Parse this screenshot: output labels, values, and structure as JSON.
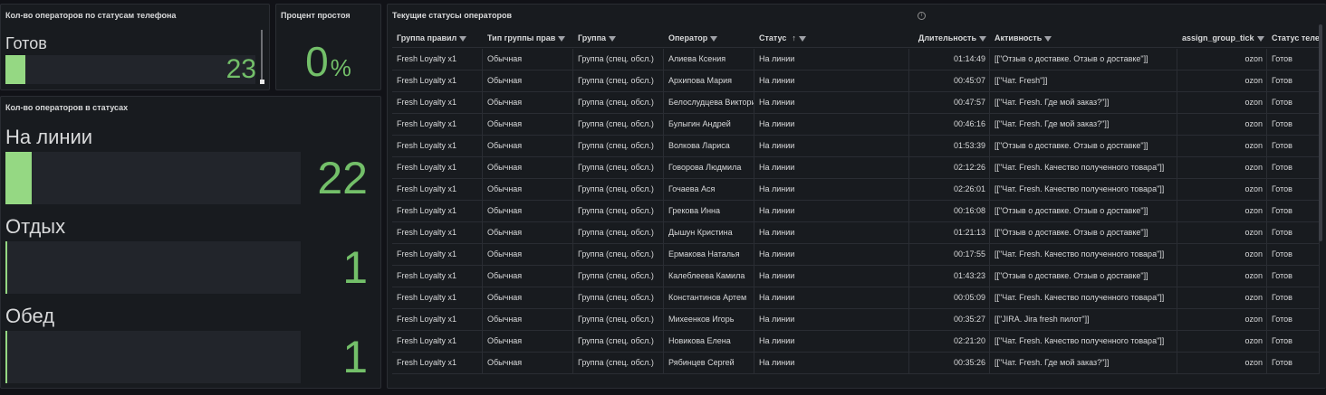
{
  "panel_phone": {
    "title": "Кол-во операторов по статусам телефона",
    "label": "Готов",
    "value": "23",
    "fill": 0.08
  },
  "panel_idle": {
    "title": "Процент простоя",
    "value": "0",
    "unit": "%"
  },
  "panel_status": {
    "title": "Кол-во операторов в статусах",
    "rows": [
      {
        "label": "На линии",
        "value": "22",
        "fill": 0.09
      },
      {
        "label": "Отдых",
        "value": "1",
        "fill": 0.005
      },
      {
        "label": "Обед",
        "value": "1",
        "fill": 0.005
      }
    ]
  },
  "panel_table": {
    "title": "Текущие статусы операторов",
    "info_icon": "info-icon",
    "columns": [
      "Группа правил",
      "Тип группы прав",
      "Группа",
      "Оператор",
      "Статус",
      "Длительность",
      "Активность",
      "assign_group_tick",
      "Статус теле"
    ],
    "sort_indicator": "↑",
    "rows": [
      [
        "Fresh Loyalty x1",
        "Обычная",
        "Группа (спец. обсл.)",
        "Алиева Ксения",
        "На линии",
        "01:14:49",
        "[[\"Отзыв о доставке. Отзыв о доставке\"]]",
        "ozon",
        "Готов"
      ],
      [
        "Fresh Loyalty x1",
        "Обычная",
        "Группа (спец. обсл.)",
        "Архипова Мария",
        "На линии",
        "00:45:07",
        "[[\"Чат. Fresh\"]]",
        "ozon",
        "Готов"
      ],
      [
        "Fresh Loyalty x1",
        "Обычная",
        "Группа (спец. обсл.)",
        "Белослудцева Виктория",
        "На линии",
        "00:47:57",
        "[[\"Чат. Fresh. Где мой заказ?\"]]",
        "ozon",
        "Готов"
      ],
      [
        "Fresh Loyalty x1",
        "Обычная",
        "Группа (спец. обсл.)",
        "Булыгин Андрей",
        "На линии",
        "00:46:16",
        "[[\"Чат. Fresh. Где мой заказ?\"]]",
        "ozon",
        "Готов"
      ],
      [
        "Fresh Loyalty x1",
        "Обычная",
        "Группа (спец. обсл.)",
        "Волкова Лариса",
        "На линии",
        "01:53:39",
        "[[\"Отзыв о доставке. Отзыв о доставке\"]]",
        "ozon",
        "Готов"
      ],
      [
        "Fresh Loyalty x1",
        "Обычная",
        "Группа (спец. обсл.)",
        "Говорова Людмила",
        "На линии",
        "02:12:26",
        "[[\"Чат. Fresh. Качество полученного товара\"]]",
        "ozon",
        "Готов"
      ],
      [
        "Fresh Loyalty x1",
        "Обычная",
        "Группа (спец. обсл.)",
        "Гочаева Ася",
        "На линии",
        "02:26:01",
        "[[\"Чат. Fresh. Качество полученного товара\"]]",
        "ozon",
        "Готов"
      ],
      [
        "Fresh Loyalty x1",
        "Обычная",
        "Группа (спец. обсл.)",
        "Грекова Инна",
        "На линии",
        "00:16:08",
        "[[\"Отзыв о доставке. Отзыв о доставке\"]]",
        "ozon",
        "Готов"
      ],
      [
        "Fresh Loyalty x1",
        "Обычная",
        "Группа (спец. обсл.)",
        "Дышун Кристина",
        "На линии",
        "01:21:13",
        "[[\"Отзыв о доставке. Отзыв о доставке\"]]",
        "ozon",
        "Готов"
      ],
      [
        "Fresh Loyalty x1",
        "Обычная",
        "Группа (спец. обсл.)",
        "Ермакова Наталья",
        "На линии",
        "00:17:55",
        "[[\"Чат. Fresh. Качество полученного товара\"]]",
        "ozon",
        "Готов"
      ],
      [
        "Fresh Loyalty x1",
        "Обычная",
        "Группа (спец. обсл.)",
        "Калеблеева Камила",
        "На линии",
        "01:43:23",
        "[[\"Отзыв о доставке. Отзыв о доставке\"]]",
        "ozon",
        "Готов"
      ],
      [
        "Fresh Loyalty x1",
        "Обычная",
        "Группа (спец. обсл.)",
        "Константинов Артем",
        "На линии",
        "00:05:09",
        "[[\"Чат. Fresh. Качество полученного товара\"]]",
        "ozon",
        "Готов"
      ],
      [
        "Fresh Loyalty x1",
        "Обычная",
        "Группа (спец. обсл.)",
        "Михеенков Игорь",
        "На линии",
        "00:35:27",
        "[[\"JIRA. Jira fresh пилот\"]]",
        "ozon",
        "Готов"
      ],
      [
        "Fresh Loyalty x1",
        "Обычная",
        "Группа (спец. обсл.)",
        "Новикова Елена",
        "На линии",
        "02:21:20",
        "[[\"Чат. Fresh. Качество полученного товара\"]]",
        "ozon",
        "Готов"
      ],
      [
        "Fresh Loyalty x1",
        "Обычная",
        "Группа (спец. обсл.)",
        "Рябинцев Сергей",
        "На линии",
        "00:35:26",
        "[[\"Чат. Fresh. Где мой заказ?\"]]",
        "ozon",
        "Готов"
      ]
    ]
  }
}
